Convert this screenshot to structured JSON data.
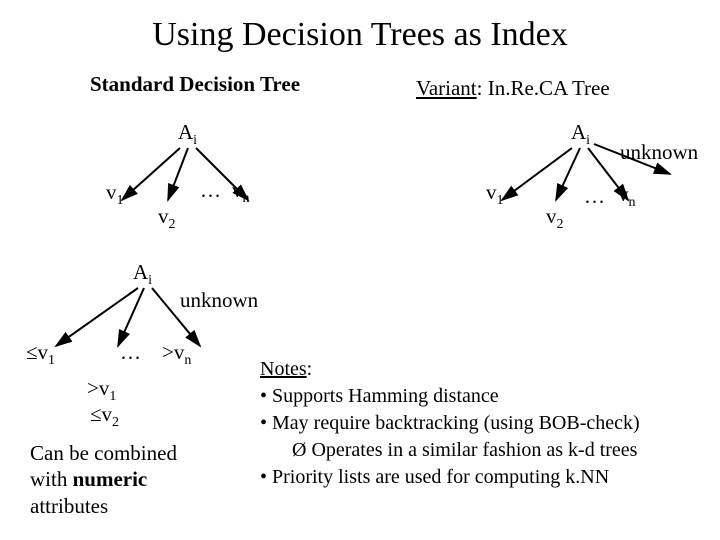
{
  "title": "Using Decision Trees as Index",
  "left": {
    "heading": "Standard Decision Tree",
    "root1": "A",
    "rootSub1": "i",
    "v1": "v",
    "v1sub": "1",
    "v2": "v",
    "v2sub": "2",
    "dots": "…",
    "vn": "v",
    "vnsub": "n",
    "root2": "A",
    "root2sub": "i",
    "unknown": "unknown",
    "le_v1": "≤v",
    "le_v1_sub": "1",
    "dots2": "…",
    "gt_vn": ">v",
    "gt_vn_sub": "n",
    "gt_v1": ">v",
    "gt_v1_sub": "1",
    "le_v2": "≤v",
    "le_v2_sub": "2"
  },
  "right": {
    "heading_prefix": "Variant",
    "heading_rest": ": In.Re.CA Tree",
    "root": "A",
    "rootSub": "i",
    "unknown": "unknown",
    "v1": "v",
    "v1sub": "1",
    "v2": "v",
    "v2sub": "2",
    "dots": "…",
    "vn": "v",
    "vnsub": "n"
  },
  "notes": {
    "heading": "Notes",
    "colon": ":",
    "n1": "• Supports Hamming distance",
    "n2": "• May require backtracking (using BOB-check)",
    "n3_prefix": "Ø ",
    "n3": "Operates in a similar fashion as k-d trees",
    "n4": "• Priority lists are used for computing k.NN"
  },
  "combine": {
    "l1": "Can be combined",
    "l2a": "with ",
    "l2b": "numeric",
    "l3": "attributes"
  }
}
